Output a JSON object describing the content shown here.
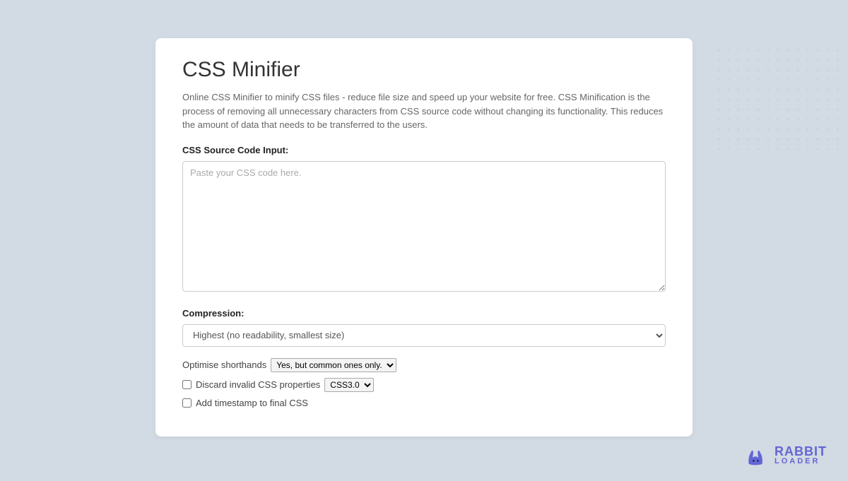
{
  "page": {
    "title": "CSS Minifier",
    "description": "Online CSS Minifier to minify CSS files - reduce file size and speed up your website for free. CSS Minification is the process of removing all unnecessary characters from CSS source code without changing its functionality. This reduces the amount of data that needs to be transferred to the users."
  },
  "form": {
    "source_label": "CSS Source Code Input:",
    "source_placeholder": "Paste your CSS code here.",
    "compression_label": "Compression:",
    "compression_value": "Highest (no readability, smallest size)",
    "optimise_label": "Optimise shorthands",
    "optimise_value": "Yes, but common ones only.",
    "discard_label": "Discard invalid CSS properties",
    "discard_value": "CSS3.0",
    "timestamp_label": "Add timestamp to final CSS"
  },
  "logo": {
    "line1": "RABBIT",
    "line2": "LOADER"
  }
}
